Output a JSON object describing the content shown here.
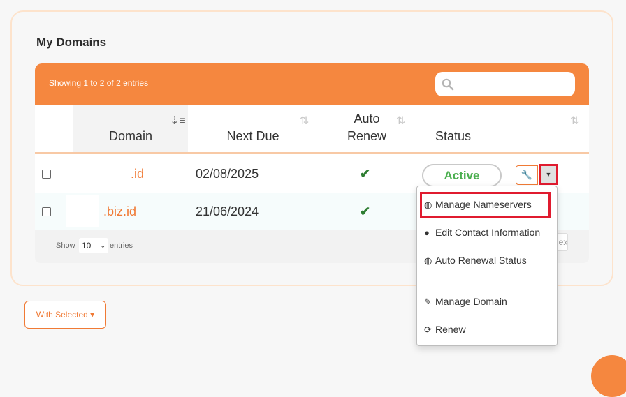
{
  "card": {
    "title": "My Domains"
  },
  "table": {
    "info": "Showing 1 to 2 of 2 entries",
    "search": {
      "value": "",
      "placeholder": ""
    },
    "headers": {
      "domain": "Domain",
      "next_due": "Next Due",
      "auto_renew_line1": "Auto",
      "auto_renew_line2": "Renew",
      "status": "Status"
    },
    "rows": [
      {
        "domain": ".id",
        "next_due": "02/08/2025",
        "auto_renew": "✔",
        "status": "Active"
      },
      {
        "domain": ".biz.id",
        "next_due": "21/06/2024",
        "auto_renew": "✔"
      }
    ],
    "footer": {
      "show": "Show",
      "length": "10",
      "entries": "entries",
      "next": "Next"
    }
  },
  "dropdown": {
    "items": [
      {
        "label": "Manage Nameservers",
        "icon": "globe-icon"
      },
      {
        "label": "Edit Contact Information",
        "icon": "user-icon"
      },
      {
        "label": "Auto Renewal Status",
        "icon": "globe-icon"
      },
      {
        "label": "Manage Domain",
        "icon": "pencil-icon"
      },
      {
        "label": "Renew",
        "icon": "refresh-icon"
      }
    ]
  },
  "bulk": {
    "label": "With Selected ▾"
  },
  "colors": {
    "accent": "#f5873f",
    "link": "#f07a35",
    "active": "#4caf50",
    "highlight": "#e01b2f"
  }
}
